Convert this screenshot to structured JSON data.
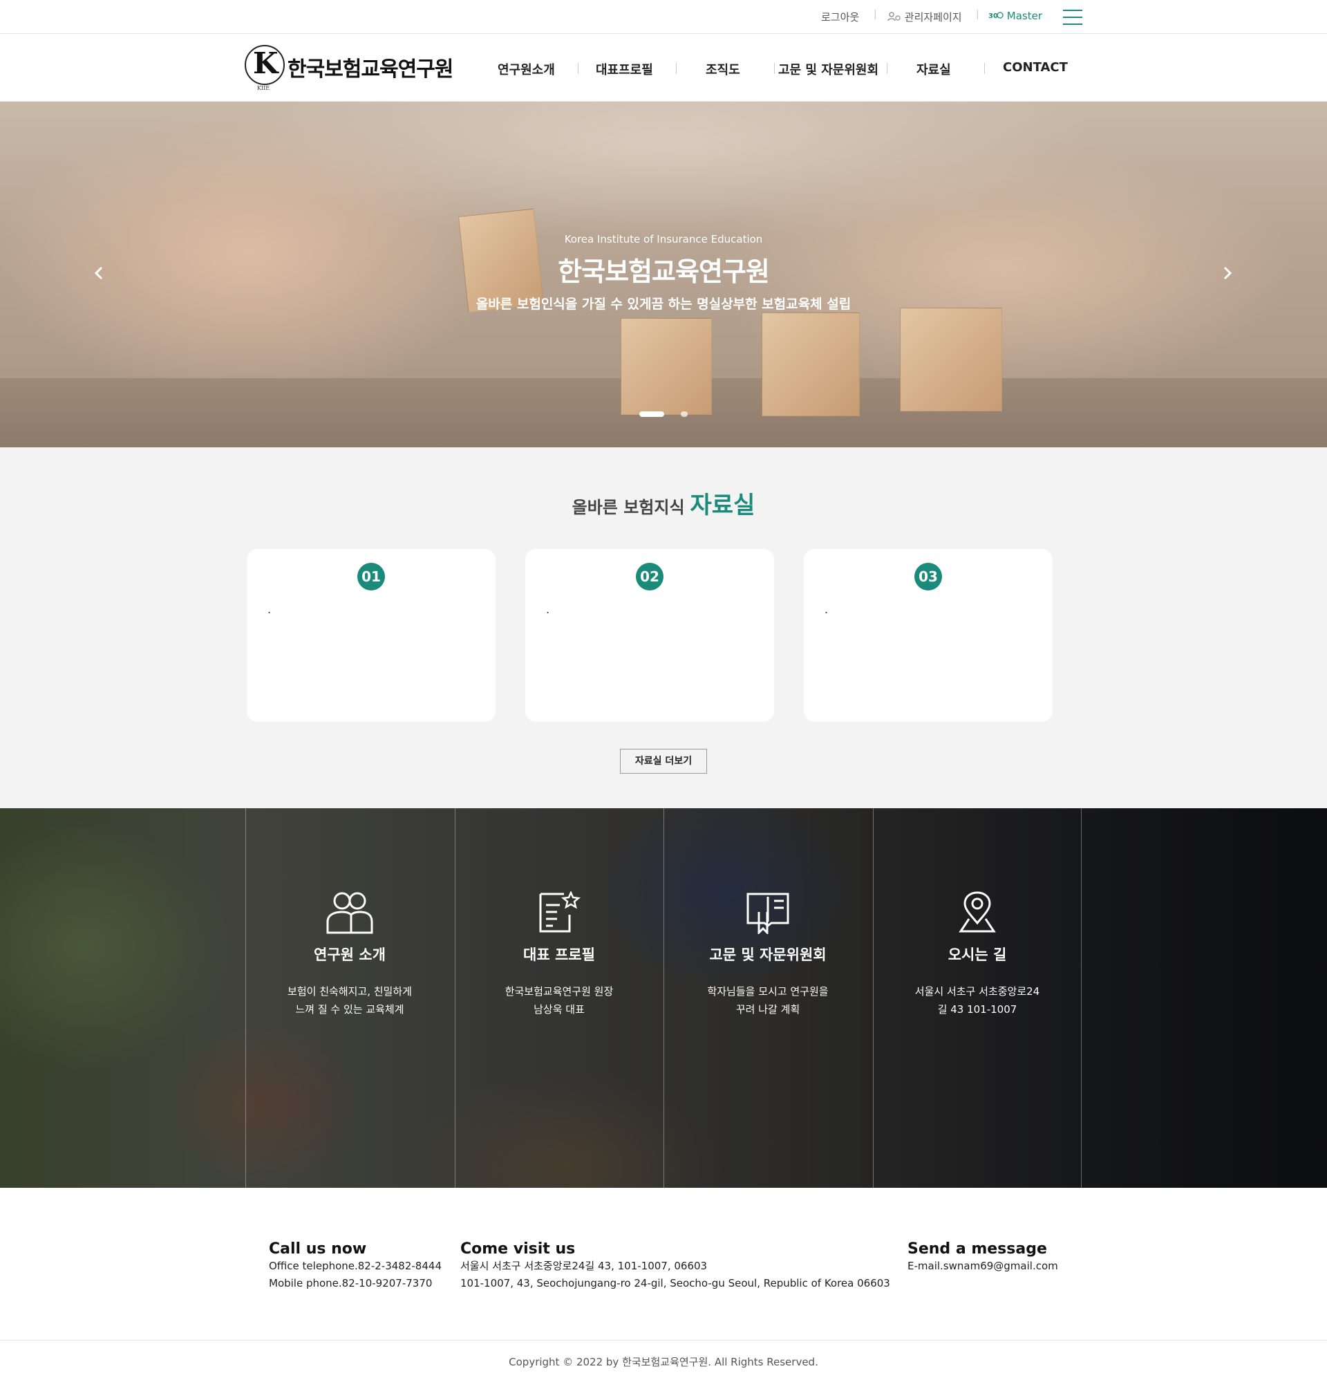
{
  "topbar": {
    "logout": "로그아웃",
    "admin": "관리자페이지",
    "master": "Master",
    "accent": "#1a8a7a"
  },
  "header": {
    "logo_name": "한국보험교육연구원",
    "logo_letter": "K",
    "logo_abbr": "KIIE",
    "nav": [
      "연구원소개",
      "대표프로필",
      "조직도",
      "고문 및 자문위원회",
      "자료실",
      "CONTACT"
    ]
  },
  "hero": {
    "subtitle": "Korea Institute of Insurance Education",
    "title": "한국보험교육연구원",
    "description": "올바른 보험인식을 가질 수 있게끔 하는 명실상부한 보험교육체 설립",
    "active_slide": 1,
    "slide_count": 2
  },
  "library": {
    "heading_pre": "올바른 보험지식",
    "heading_strong": "자료실",
    "cards": [
      {
        "num": "01",
        "text": "."
      },
      {
        "num": "02",
        "text": "."
      },
      {
        "num": "03",
        "text": "."
      }
    ],
    "more_button": "자료실 더보기"
  },
  "features": [
    {
      "icon": "people-icon",
      "title": "연구원 소개",
      "desc1": "보험이 친숙해지고, 친밀하게",
      "desc2": "느껴 질 수 있는 교육체계"
    },
    {
      "icon": "profile-document-icon",
      "title": "대표 프로필",
      "desc1": "한국보험교육연구원 원장",
      "desc2": "남상욱 대표"
    },
    {
      "icon": "book-icon",
      "title": "고문 및 자문위원회",
      "desc1": "학자님들을 모시고 연구원을",
      "desc2": "꾸려 나갈 계획"
    },
    {
      "icon": "location-pin-icon",
      "title": "오시는 길",
      "desc1": "서울시 서초구 서초중앙로24",
      "desc2": "길 43 101-1007"
    }
  ],
  "contact": {
    "call": {
      "title": "Call us now",
      "line1": "Office telephone.82-2-3482-8444",
      "line2": "Mobile phone.82-10-9207-7370"
    },
    "visit": {
      "title": "Come visit us",
      "line1": "서울시 서초구 서초중앙로24길 43, 101-1007, 06603",
      "line2": "101-1007, 43, Seochojungang-ro 24-gil, Seocho-gu Seoul, Republic of Korea 06603"
    },
    "message": {
      "title": "Send a message",
      "line1": "E-mail.swnam69@gmail.com"
    }
  },
  "copyright": "Copyright © 2022 by 한국보험교육연구원. All Rights Reserved."
}
